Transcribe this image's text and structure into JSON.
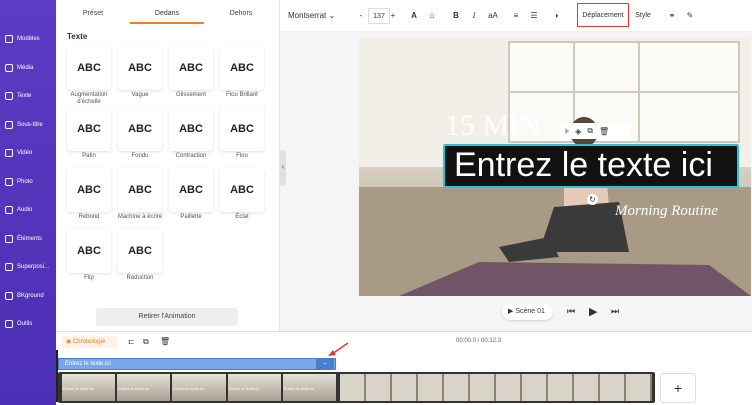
{
  "sidebar": {
    "items": [
      {
        "label": "Modèles",
        "icon": "layout-icon"
      },
      {
        "label": "Média",
        "icon": "folder-icon"
      },
      {
        "label": "Texte",
        "icon": "text-icon"
      },
      {
        "label": "Sous-titre",
        "icon": "subtitle-icon"
      },
      {
        "label": "Vidéo",
        "icon": "video-icon"
      },
      {
        "label": "Photo",
        "icon": "image-icon"
      },
      {
        "label": "Audio",
        "icon": "music-icon"
      },
      {
        "label": "Éléments",
        "icon": "elements-icon"
      },
      {
        "label": "Superposi...",
        "icon": "overlay-icon"
      },
      {
        "label": "BKground",
        "icon": "background-icon"
      },
      {
        "label": "Outils",
        "icon": "tools-icon"
      }
    ]
  },
  "panel": {
    "tabs": [
      "Préset",
      "Dedans",
      "Dehors"
    ],
    "section": "Texte",
    "cards": [
      {
        "glyph": "ABC",
        "label": "Augmentation d'échelle"
      },
      {
        "glyph": "ABC",
        "label": "Vague"
      },
      {
        "glyph": "ABC",
        "label": "Glissement"
      },
      {
        "glyph": "ABC",
        "label": "Flou Brillant"
      },
      {
        "glyph": "ABC",
        "label": "Patin"
      },
      {
        "glyph": "ABC",
        "label": "Fondu"
      },
      {
        "glyph": "ABC",
        "label": "Contraction"
      },
      {
        "glyph": "ABC",
        "label": "Flou"
      },
      {
        "glyph": "ABC",
        "label": "Rebond"
      },
      {
        "glyph": "ABC",
        "label": "Machine à écrire"
      },
      {
        "glyph": "ABC",
        "label": "Paillette"
      },
      {
        "glyph": "ABC",
        "label": "Éclat"
      },
      {
        "glyph": "ABC",
        "label": "Flip"
      },
      {
        "glyph": "ABC",
        "label": "Réduction"
      }
    ],
    "remove_label": "Retirer l'Animation"
  },
  "toolbar": {
    "font": "Montserrat",
    "font_size": "137",
    "minus": "-",
    "plus": "+",
    "case_label": "aA",
    "deplacement": "Déplacement",
    "style": "Style"
  },
  "canvas": {
    "title_text": "15 MIN",
    "main_text": "Entrez le texte ici",
    "subtitle_text": "Morning Routine",
    "scene_label": "Scène 01"
  },
  "timeline": {
    "label": "Chronologie",
    "time": "00:00.0 / 00:12.3",
    "track_label": "Entrez le texte ici",
    "thumb_text": "Entrez le texte ici",
    "add": "+"
  },
  "colors": {
    "accent": "#f47c20",
    "sidebar": "#5136bd",
    "highlight": "#e53935",
    "selection": "#1ec8d8",
    "track": "#7aa7e8"
  }
}
